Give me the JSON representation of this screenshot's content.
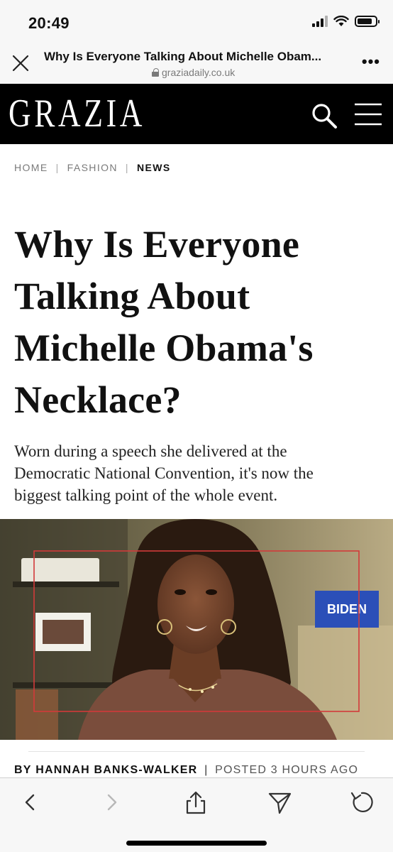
{
  "status_bar": {
    "time": "20:49",
    "battery_level": 0.85
  },
  "browser": {
    "page_title": "Why Is Everyone Talking About Michelle Obam...",
    "url": "graziadaily.co.uk",
    "more_label": "•••"
  },
  "site": {
    "logo": "GRAZIA"
  },
  "breadcrumb": {
    "home": "HOME",
    "section": "FASHION",
    "current": "NEWS",
    "separator": "|"
  },
  "article": {
    "headline_lines": [
      "Why Is Everyone",
      "Talking About",
      "Michelle Obama's",
      "Necklace?"
    ],
    "standfirst_lines": [
      "Worn during a speech she delivered at the",
      "Democratic National Convention, it's now the",
      "biggest talking point of the whole event."
    ],
    "byline_prefix": "BY",
    "author": "HANNAH BANKS-WALKER",
    "byline_separator": "|",
    "posted": "POSTED 3 HOURS AGO",
    "hero_sign_text": "BIDEN"
  },
  "toolbar": {
    "icons": [
      "back-icon",
      "forward-icon",
      "share-icon",
      "send-icon",
      "reload-icon"
    ]
  },
  "colors": {
    "header_bg": "#000000",
    "highlight_box": "#d23a3a",
    "sign_blue": "#2b4fb8"
  }
}
